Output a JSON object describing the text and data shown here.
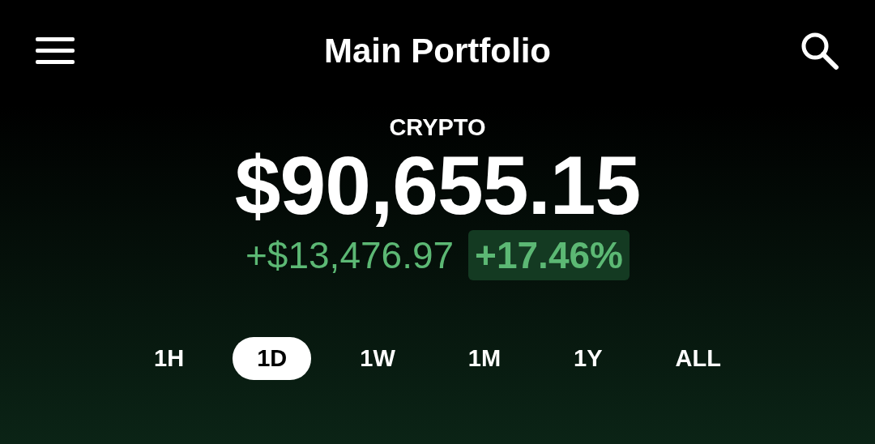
{
  "header": {
    "title": "Main Portfolio"
  },
  "portfolio": {
    "label": "CRYPTO",
    "value": "$90,655.15",
    "change": "+$13,476.97",
    "change_percent": "+17.46%"
  },
  "ranges": [
    {
      "label": "1H",
      "selected": false
    },
    {
      "label": "1D",
      "selected": true
    },
    {
      "label": "1W",
      "selected": false
    },
    {
      "label": "1M",
      "selected": false
    },
    {
      "label": "1Y",
      "selected": false
    },
    {
      "label": "ALL",
      "selected": false
    }
  ]
}
